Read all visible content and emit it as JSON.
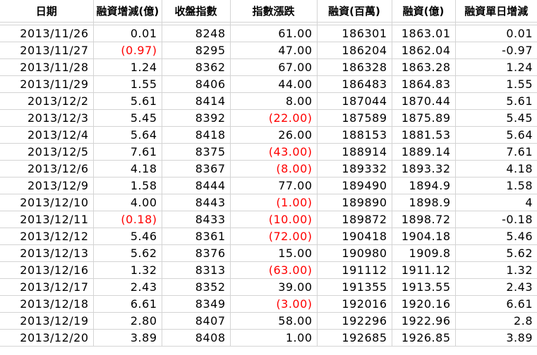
{
  "headers": [
    "日期",
    "融資增減(億)",
    "收盤指數",
    "指數漲跌",
    "融資(百萬)",
    "融資(億)",
    "融資單日增減"
  ],
  "colors": {
    "negative": "#ff0000",
    "grid": "#d4d4d4",
    "text": "#000000"
  },
  "rows": [
    {
      "date": "2013/11/26",
      "change_yi": "0.01",
      "close": "8248",
      "index_change": "61.00",
      "margin_mn": "186301",
      "margin_yi": "1863.01",
      "daily_change": "0.01",
      "change_yi_neg": false,
      "index_change_neg": false
    },
    {
      "date": "2013/11/27",
      "change_yi": "(0.97)",
      "close": "8295",
      "index_change": "47.00",
      "margin_mn": "186204",
      "margin_yi": "1862.04",
      "daily_change": "-0.97",
      "change_yi_neg": true,
      "index_change_neg": false
    },
    {
      "date": "2013/11/28",
      "change_yi": "1.24",
      "close": "8362",
      "index_change": "67.00",
      "margin_mn": "186328",
      "margin_yi": "1863.28",
      "daily_change": "1.24",
      "change_yi_neg": false,
      "index_change_neg": false
    },
    {
      "date": "2013/11/29",
      "change_yi": "1.55",
      "close": "8406",
      "index_change": "44.00",
      "margin_mn": "186483",
      "margin_yi": "1864.83",
      "daily_change": "1.55",
      "change_yi_neg": false,
      "index_change_neg": false
    },
    {
      "date": "2013/12/2",
      "change_yi": "5.61",
      "close": "8414",
      "index_change": "8.00",
      "margin_mn": "187044",
      "margin_yi": "1870.44",
      "daily_change": "5.61",
      "change_yi_neg": false,
      "index_change_neg": false
    },
    {
      "date": "2013/12/3",
      "change_yi": "5.45",
      "close": "8392",
      "index_change": "(22.00)",
      "margin_mn": "187589",
      "margin_yi": "1875.89",
      "daily_change": "5.45",
      "change_yi_neg": false,
      "index_change_neg": true
    },
    {
      "date": "2013/12/4",
      "change_yi": "5.64",
      "close": "8418",
      "index_change": "26.00",
      "margin_mn": "188153",
      "margin_yi": "1881.53",
      "daily_change": "5.64",
      "change_yi_neg": false,
      "index_change_neg": false
    },
    {
      "date": "2013/12/5",
      "change_yi": "7.61",
      "close": "8375",
      "index_change": "(43.00)",
      "margin_mn": "188914",
      "margin_yi": "1889.14",
      "daily_change": "7.61",
      "change_yi_neg": false,
      "index_change_neg": true
    },
    {
      "date": "2013/12/6",
      "change_yi": "4.18",
      "close": "8367",
      "index_change": "(8.00)",
      "margin_mn": "189332",
      "margin_yi": "1893.32",
      "daily_change": "4.18",
      "change_yi_neg": false,
      "index_change_neg": true
    },
    {
      "date": "2013/12/9",
      "change_yi": "1.58",
      "close": "8444",
      "index_change": "77.00",
      "margin_mn": "189490",
      "margin_yi": "1894.9",
      "daily_change": "1.58",
      "change_yi_neg": false,
      "index_change_neg": false
    },
    {
      "date": "2013/12/10",
      "change_yi": "4.00",
      "close": "8443",
      "index_change": "(1.00)",
      "margin_mn": "189890",
      "margin_yi": "1898.9",
      "daily_change": "4",
      "change_yi_neg": false,
      "index_change_neg": true
    },
    {
      "date": "2013/12/11",
      "change_yi": "(0.18)",
      "close": "8433",
      "index_change": "(10.00)",
      "margin_mn": "189872",
      "margin_yi": "1898.72",
      "daily_change": "-0.18",
      "change_yi_neg": true,
      "index_change_neg": true
    },
    {
      "date": "2013/12/12",
      "change_yi": "5.46",
      "close": "8361",
      "index_change": "(72.00)",
      "margin_mn": "190418",
      "margin_yi": "1904.18",
      "daily_change": "5.46",
      "change_yi_neg": false,
      "index_change_neg": true
    },
    {
      "date": "2013/12/13",
      "change_yi": "5.62",
      "close": "8376",
      "index_change": "15.00",
      "margin_mn": "190980",
      "margin_yi": "1909.8",
      "daily_change": "5.62",
      "change_yi_neg": false,
      "index_change_neg": false
    },
    {
      "date": "2013/12/16",
      "change_yi": "1.32",
      "close": "8313",
      "index_change": "(63.00)",
      "margin_mn": "191112",
      "margin_yi": "1911.12",
      "daily_change": "1.32",
      "change_yi_neg": false,
      "index_change_neg": true
    },
    {
      "date": "2013/12/17",
      "change_yi": "2.43",
      "close": "8352",
      "index_change": "39.00",
      "margin_mn": "191355",
      "margin_yi": "1913.55",
      "daily_change": "2.43",
      "change_yi_neg": false,
      "index_change_neg": false
    },
    {
      "date": "2013/12/18",
      "change_yi": "6.61",
      "close": "8349",
      "index_change": "(3.00)",
      "margin_mn": "192016",
      "margin_yi": "1920.16",
      "daily_change": "6.61",
      "change_yi_neg": false,
      "index_change_neg": true
    },
    {
      "date": "2013/12/19",
      "change_yi": "2.80",
      "close": "8407",
      "index_change": "58.00",
      "margin_mn": "192296",
      "margin_yi": "1922.96",
      "daily_change": "2.8",
      "change_yi_neg": false,
      "index_change_neg": false
    },
    {
      "date": "2013/12/20",
      "change_yi": "3.89",
      "close": "8408",
      "index_change": "1.00",
      "margin_mn": "192685",
      "margin_yi": "1926.85",
      "daily_change": "3.89",
      "change_yi_neg": false,
      "index_change_neg": false
    }
  ]
}
